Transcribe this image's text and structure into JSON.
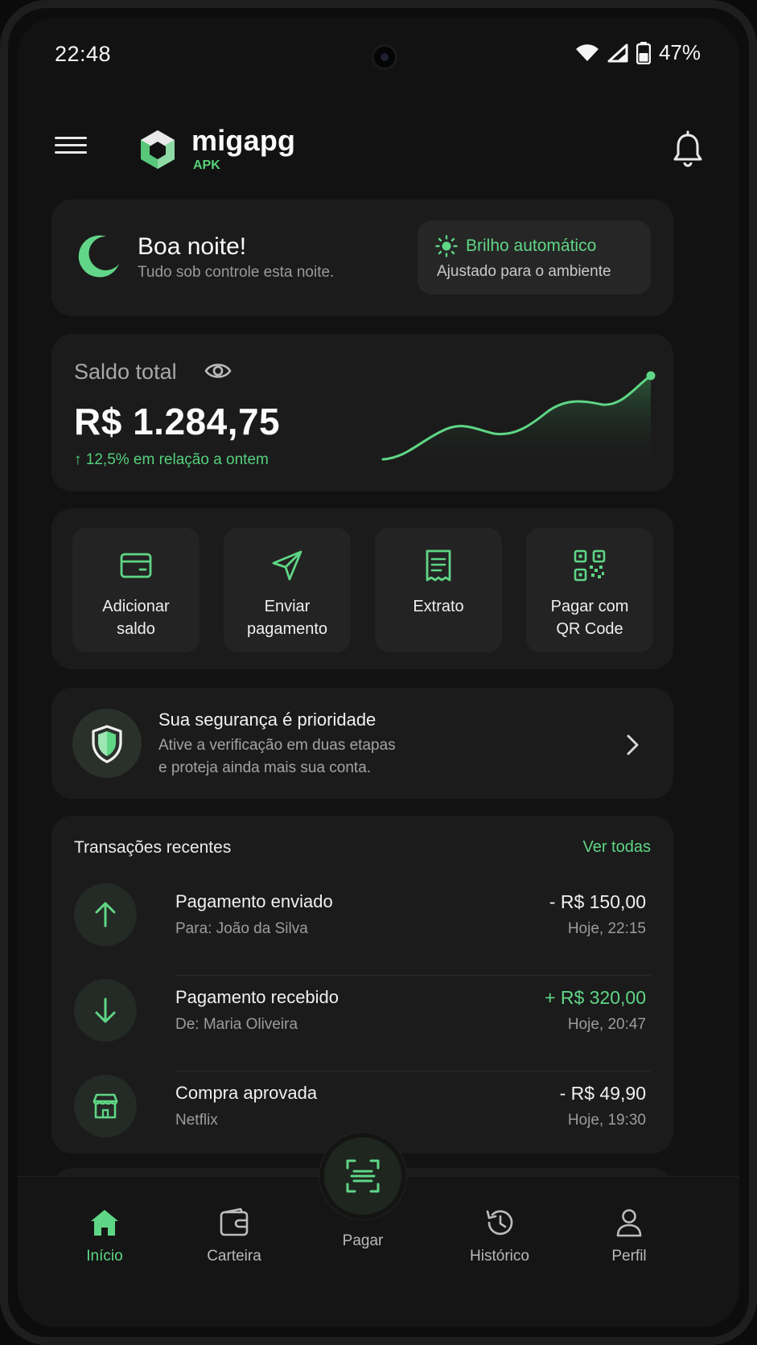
{
  "status_bar": {
    "time": "22:48",
    "battery": "47%"
  },
  "header": {
    "brand": "migapg",
    "brand_sub": "APK"
  },
  "greeting": {
    "title": "Boa noite!",
    "subtitle": "Tudo sob controle esta noite.",
    "brightness_title": "Brilho automático",
    "brightness_sub": "Ajustado para o ambiente"
  },
  "balance": {
    "label": "Saldo total",
    "value": "R$ 1.284,75",
    "change": "↑ 12,5% em relação a ontem"
  },
  "actions": [
    {
      "line1": "Adicionar",
      "line2": "saldo",
      "icon": "wallet-card-icon"
    },
    {
      "line1": "Enviar",
      "line2": "pagamento",
      "icon": "send-icon"
    },
    {
      "line1": "Extrato",
      "line2": "",
      "icon": "receipt-icon"
    },
    {
      "line1": "Pagar com",
      "line2": "QR Code",
      "icon": "qr-code-icon"
    }
  ],
  "security": {
    "title": "Sua segurança é prioridade",
    "line1": "Ative a verificação em duas etapas",
    "line2": "e proteja ainda mais sua conta."
  },
  "transactions": {
    "title": "Transações recentes",
    "see_all": "Ver todas",
    "items": [
      {
        "name": "Pagamento enviado",
        "who": "Para: João da Silva",
        "amount": "- R$ 150,00",
        "date": "Hoje, 22:15",
        "type": "out"
      },
      {
        "name": "Pagamento recebido",
        "who": "De: Maria Oliveira",
        "amount": "+ R$ 320,00",
        "date": "Hoje, 20:47",
        "type": "in"
      },
      {
        "name": "Compra aprovada",
        "who": "Netflix",
        "amount": "- R$ 49,90",
        "date": "Hoje, 19:30",
        "type": "store"
      }
    ]
  },
  "nav": {
    "home": "Início",
    "wallet": "Carteira",
    "pay": "Pagar",
    "history": "Histórico",
    "profile": "Perfil"
  },
  "colors": {
    "accent": "#5fd685",
    "background": "#121212",
    "card": "#1b1b1b"
  }
}
